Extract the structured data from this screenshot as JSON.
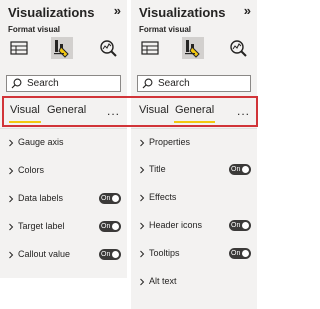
{
  "left_panel": {
    "title": "Visualizations",
    "collapse_icon": "double-chevron-right",
    "subtitle": "Format visual",
    "icons": [
      "build-visual-icon",
      "format-visual-icon",
      "analytics-icon"
    ],
    "selected_icon": "format-visual-icon",
    "search": {
      "placeholder": "Search"
    },
    "tabs": [
      {
        "label": "Visual",
        "active": true
      },
      {
        "label": "General",
        "active": false
      }
    ],
    "more": "...",
    "cards": [
      {
        "label": "Gauge axis"
      },
      {
        "label": "Colors"
      },
      {
        "label": "Data labels",
        "toggle": "On"
      },
      {
        "label": "Target label",
        "toggle": "On"
      },
      {
        "label": "Callout value",
        "toggle": "On"
      }
    ]
  },
  "right_panel": {
    "title": "Visualizations",
    "collapse_icon": "double-chevron-right",
    "subtitle": "Format visual",
    "icons": [
      "build-visual-icon",
      "format-visual-icon",
      "analytics-icon"
    ],
    "selected_icon": "format-visual-icon",
    "search": {
      "placeholder": "Search"
    },
    "tabs": [
      {
        "label": "Visual",
        "active": false
      },
      {
        "label": "General",
        "active": true
      }
    ],
    "more": "...",
    "cards": [
      {
        "label": "Properties"
      },
      {
        "label": "Title",
        "toggle": "On"
      },
      {
        "label": "Effects"
      },
      {
        "label": "Header icons",
        "toggle": "On"
      },
      {
        "label": "Tooltips",
        "toggle": "On"
      },
      {
        "label": "Alt text"
      }
    ]
  },
  "colors": {
    "highlight": "#d13438",
    "tab_underline": "#f2c811",
    "panel_bg": "#f3f2f1",
    "toggle_on": "#3b3a39"
  }
}
